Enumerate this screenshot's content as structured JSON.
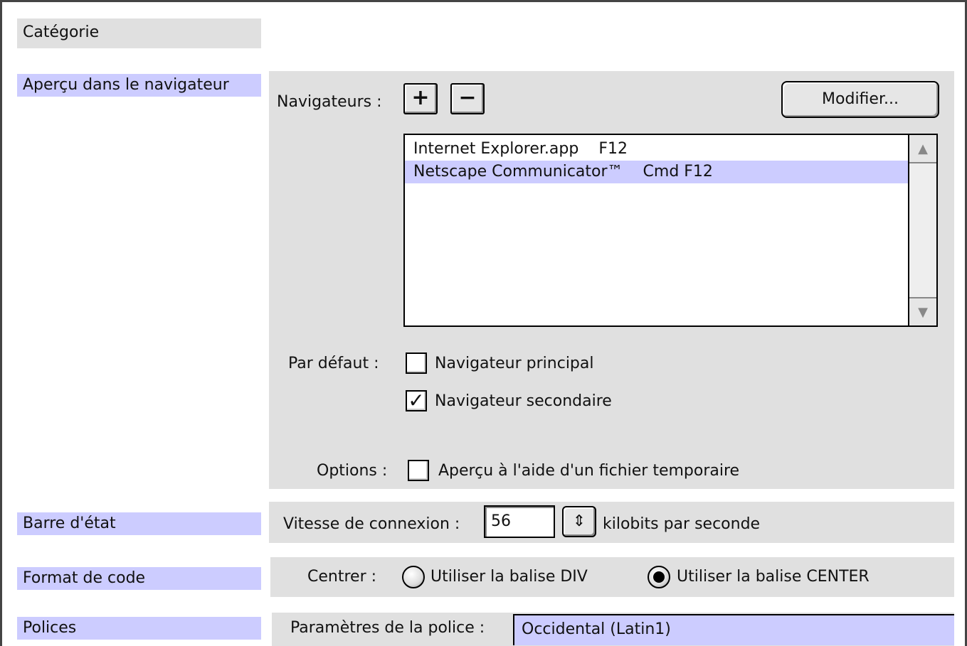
{
  "categories": {
    "header": "Catégorie",
    "items": [
      "Aperçu dans le navigateur",
      "Barre d'état",
      "Format de code",
      "Polices"
    ]
  },
  "browsers": {
    "label": "Navigateurs :",
    "add_icon": "plus-icon",
    "remove_icon": "minus-icon",
    "add_glyph": "+",
    "remove_glyph": "−",
    "modify_label": "Modifier...",
    "list": [
      {
        "name": "Internet Explorer.app",
        "shortcut": "F12",
        "selected": false
      },
      {
        "name": "Netscape Communicator™",
        "shortcut": "Cmd F12",
        "selected": true
      }
    ]
  },
  "defaults": {
    "label": "Par défaut :",
    "primary_label": "Navigateur principal",
    "primary_checked": false,
    "secondary_label": "Navigateur secondaire",
    "secondary_checked": true
  },
  "options": {
    "label": "Options :",
    "temp_file_label": "Aperçu à l'aide d'un fichier temporaire",
    "temp_file_checked": false
  },
  "status_bar": {
    "speed_label": "Vitesse de connexion :",
    "speed_value": "56",
    "speed_unit": "kilobits par seconde"
  },
  "code_format": {
    "center_label": "Centrer :",
    "option_div": "Utiliser la balise DIV",
    "option_center": "Utiliser la balise CENTER",
    "selected": "center"
  },
  "fonts": {
    "settings_label": "Paramètres de la police :",
    "settings_value": "Occidental (Latin1)"
  },
  "colors": {
    "selection": "#ccccff",
    "panel": "#e0e0e0"
  }
}
